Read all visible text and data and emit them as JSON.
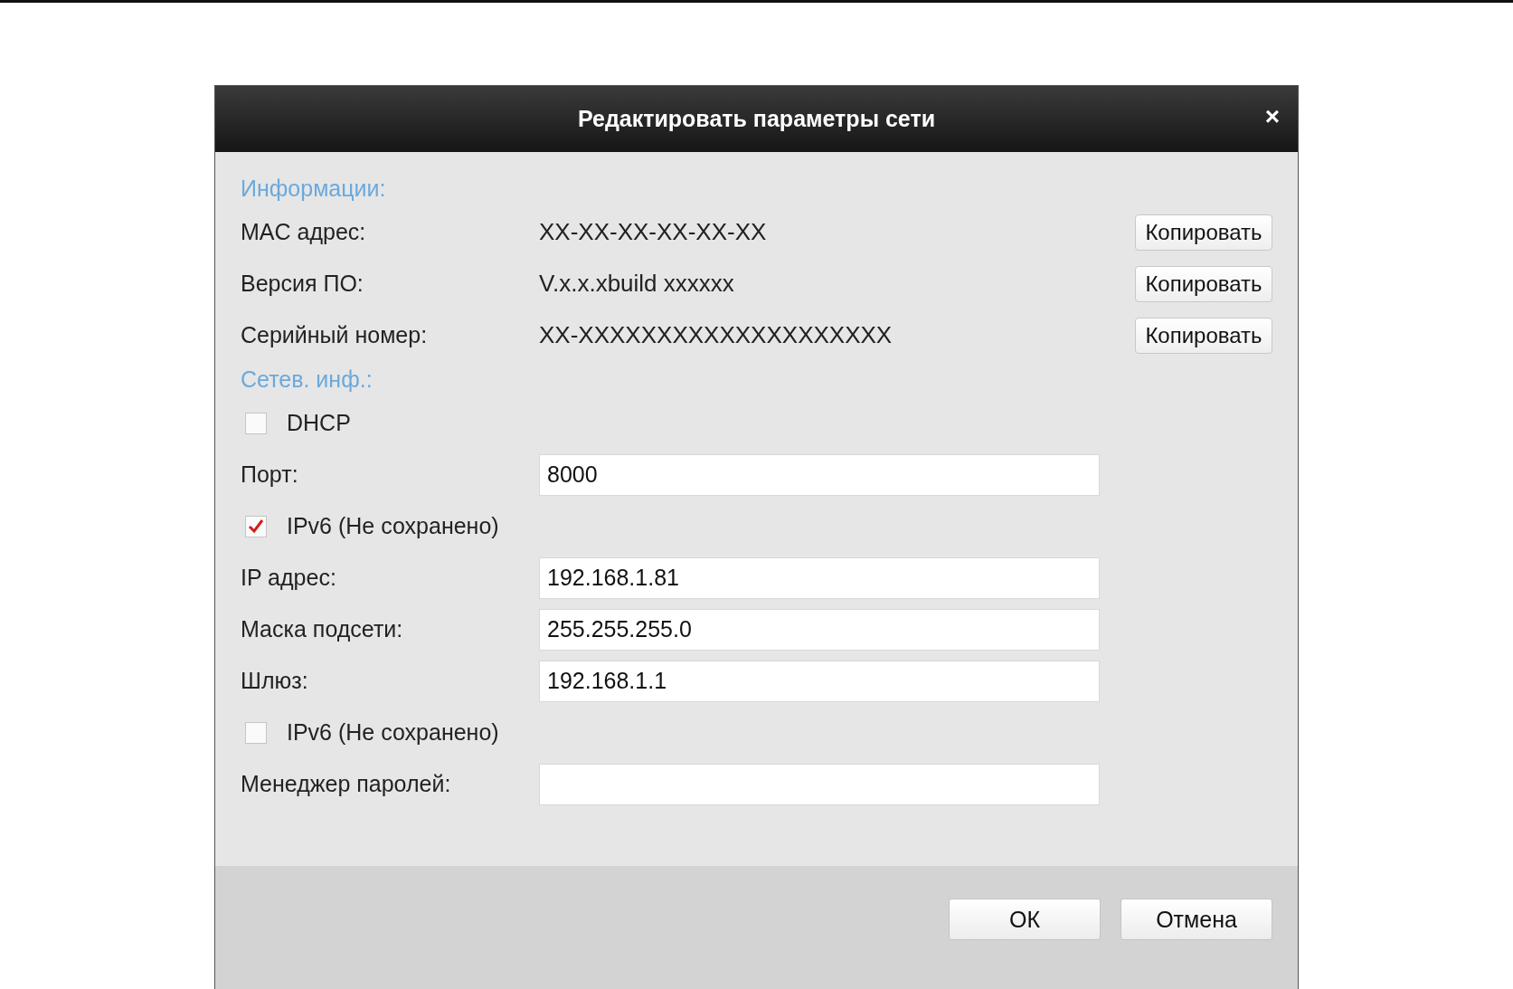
{
  "window": {
    "title": "Редактировать параметры сети",
    "close": "×"
  },
  "sections": [
    {
      "heading": "Информации:",
      "rows": [
        {
          "kind": "copy",
          "label": "MAC адрес:",
          "value": "XX-XX-XX-XX-XX-XX",
          "button": "Копировать"
        },
        {
          "kind": "copy",
          "label": "Версия ПО:",
          "value": "V.x.x.xbuild xxxxxx",
          "button": "Копировать"
        },
        {
          "kind": "copy",
          "label": "Серийный номер:",
          "value": "XX-XXXXXXXXXXXXXXXXXXXX",
          "button": "Копировать"
        }
      ]
    },
    {
      "heading": "Сетев. инф.:",
      "rows": [
        {
          "kind": "checkbox",
          "label": "DHCP",
          "checked": false
        },
        {
          "kind": "field",
          "label": "Порт:",
          "value": "8000"
        },
        {
          "kind": "checkbox",
          "label": "IPv6 (Не сохранено)",
          "checked": true
        },
        {
          "kind": "field",
          "label": "IP адрес:",
          "value": "192.168.1.81"
        },
        {
          "kind": "field",
          "label": "Маска подсети:",
          "value": "255.255.255.0"
        },
        {
          "kind": "field",
          "label": "Шлюз:",
          "value": "192.168.1.1"
        },
        {
          "kind": "checkbox",
          "label": "IPv6 (Не сохранено)",
          "checked": false
        },
        {
          "kind": "field",
          "label": "Менеджер паролей:"
        }
      ]
    }
  ],
  "buttons": [
    "ОК",
    "Отмена"
  ]
}
